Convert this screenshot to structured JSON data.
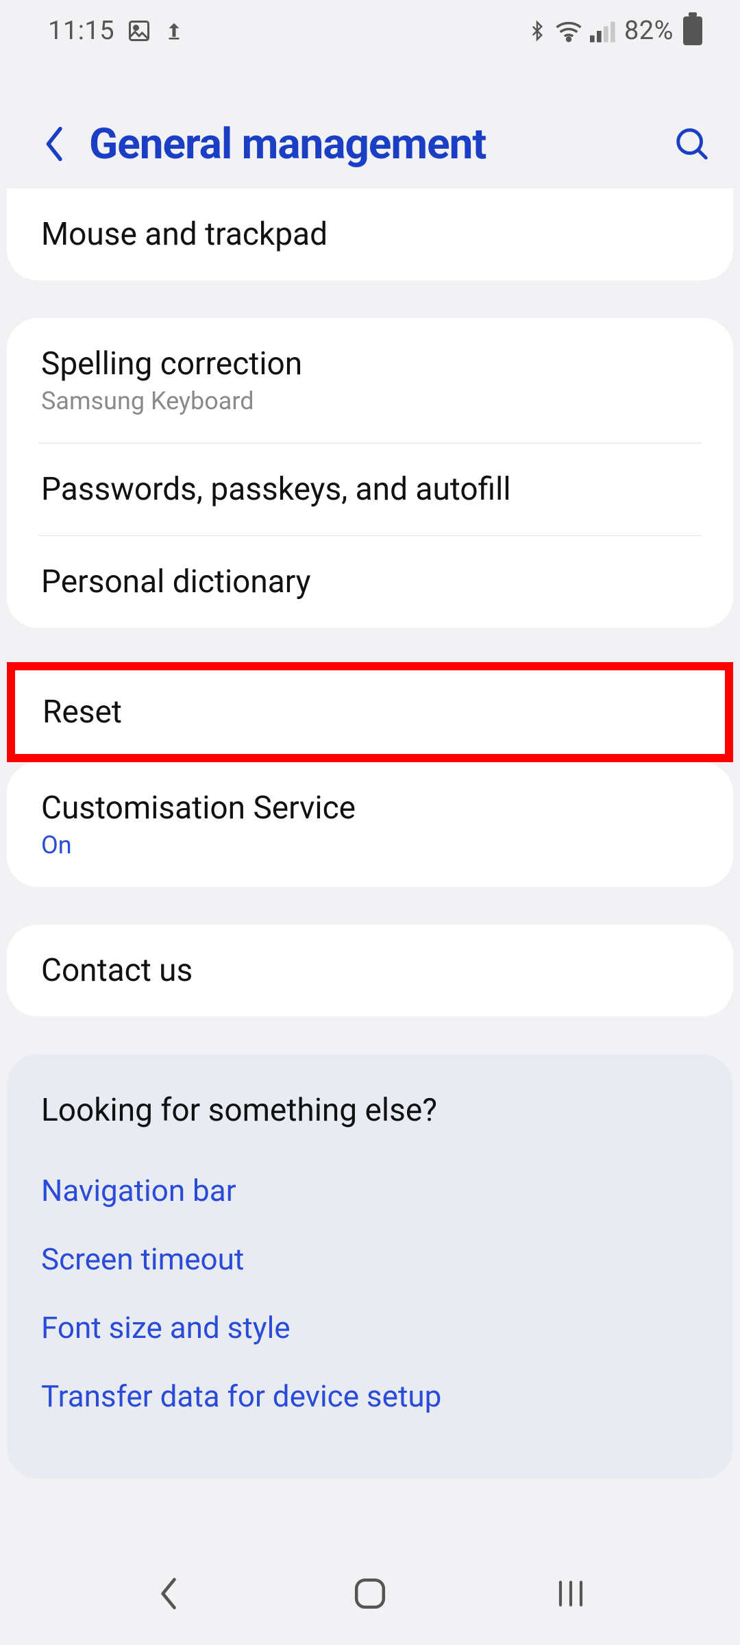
{
  "status": {
    "time": "11:15",
    "battery_text": "82%"
  },
  "header": {
    "title": "General management"
  },
  "cards": {
    "mouse_trackpad": "Mouse and trackpad",
    "spelling": {
      "title": "Spelling correction",
      "sub": "Samsung Keyboard"
    },
    "passwords": "Passwords, passkeys, and autofill",
    "personal_dict": "Personal dictionary",
    "reset": "Reset",
    "customisation": {
      "title": "Customisation Service",
      "status": "On"
    },
    "contact": "Contact us"
  },
  "suggest": {
    "title": "Looking for something else?",
    "links": [
      "Navigation bar",
      "Screen timeout",
      "Font size and style",
      "Transfer data for device setup"
    ]
  }
}
